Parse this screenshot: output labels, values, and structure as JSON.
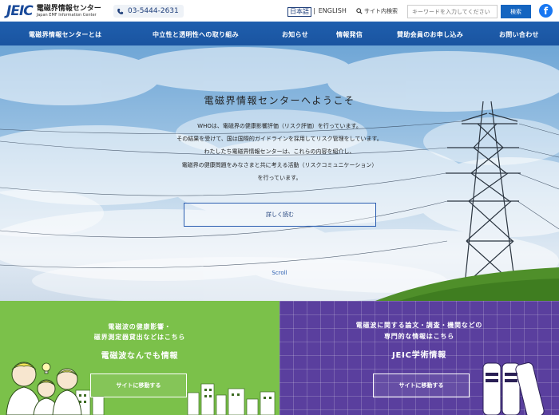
{
  "header": {
    "logo_mark": "JEIC",
    "logo_jp": "電磁界情報センター",
    "logo_en": "Japan EMF Information Center",
    "phone": "03-5444-2631",
    "lang_ja": "日本語",
    "lang_sep": "|",
    "lang_en": "ENGLISH",
    "search_label": "サイト内検索",
    "search_placeholder": "キーワードを入力してください",
    "search_button": "検索",
    "facebook": "f"
  },
  "nav": {
    "items": [
      "電磁界情報センターとは",
      "中立性と透明性への取り組み",
      "お知らせ",
      "情報発信",
      "賛助会員のお申し込み",
      "お問い合わせ"
    ]
  },
  "hero": {
    "title": "電磁界情報センターへようこそ",
    "lines": [
      "WHOは、電磁界の健康影響評価（リスク評価）を行っています。",
      "その結果を受けて、国は国際的ガイドラインを採用してリスク管理をしています。",
      "わたしたち電磁界情報センターは、これらの内容を紹介し、",
      "電磁界の健康問題をみなさまと共に考える活動（リスクコミュニケーション）",
      "を行っています。"
    ],
    "button": "詳しく読む",
    "scroll": "Scroll"
  },
  "panels": {
    "left": {
      "line1": "電磁波の健康影響・",
      "line2": "磁界測定器貸出などはこちら",
      "title": "電磁波なんでも情報",
      "button": "サイトに移動する"
    },
    "right": {
      "line1": "電磁波に関する論文・調査・機関などの",
      "line2": "専門的な情報はこちら",
      "title": "JEIC学術情報",
      "button": "サイトに移動する"
    }
  },
  "colors": {
    "brand": "#1a4a99",
    "nav": "#1f5fae",
    "left_panel": "#7bc14a",
    "right_panel": "#5a3f9e",
    "search_button": "#1565c0",
    "facebook": "#1877f2"
  }
}
